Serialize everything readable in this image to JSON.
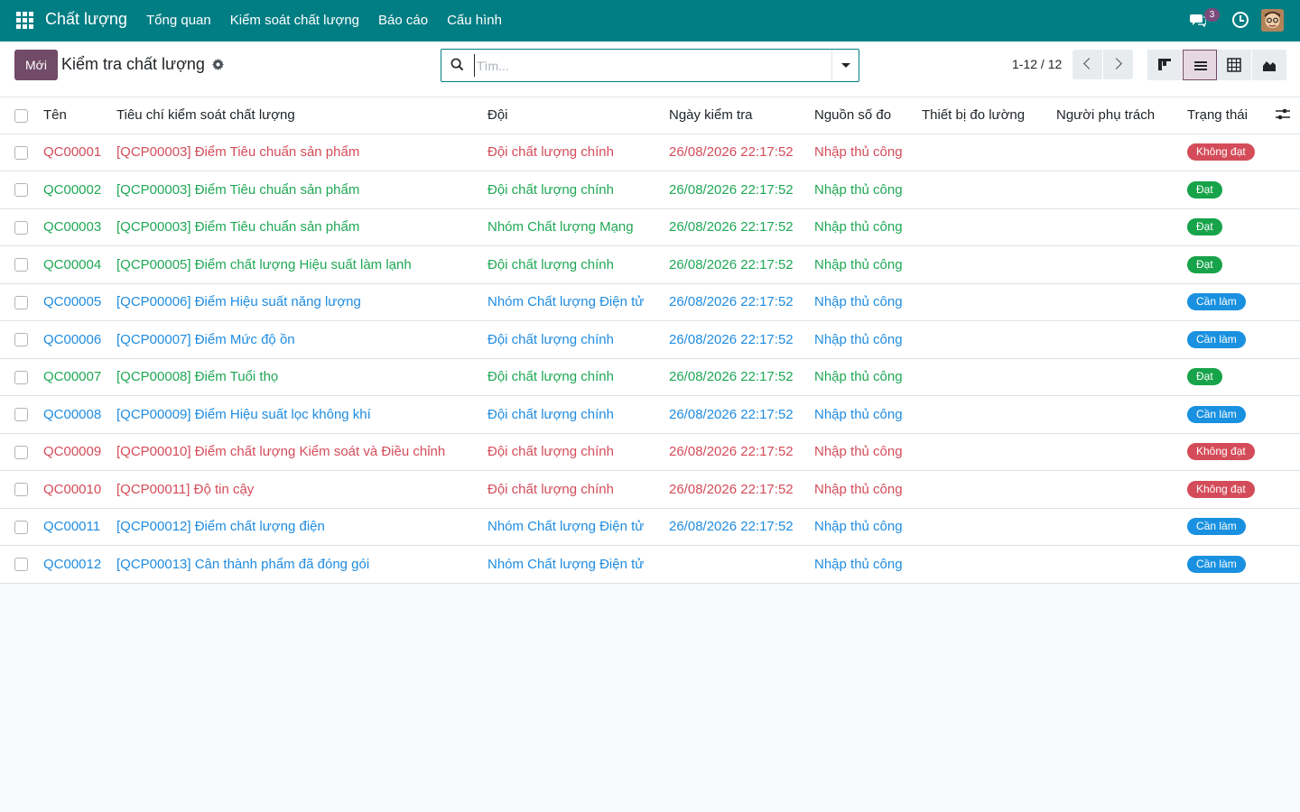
{
  "navbar": {
    "brand": "Chất lượng",
    "menu": [
      {
        "label": "Tổng quan"
      },
      {
        "label": "Kiểm soát chất lượng"
      },
      {
        "label": "Báo cáo"
      },
      {
        "label": "Cấu hình"
      }
    ],
    "chat_badge": "3"
  },
  "control": {
    "new_label": "Mới",
    "title": "Kiểm tra chất lượng",
    "search_placeholder": "Tìm...",
    "pager": "1-12 / 12"
  },
  "table": {
    "headers": {
      "name": "Tên",
      "criteria": "Tiêu chí kiểm soát chất lượng",
      "team": "Đội",
      "date": "Ngày kiểm tra",
      "source": "Nguồn số đo",
      "device": "Thiết bị đo lường",
      "responsible": "Người phụ trách",
      "status": "Trạng thái"
    },
    "rows": [
      {
        "name": "QC00001",
        "criteria": "[QCP00003] Điểm Tiêu chuẩn sản phẩm",
        "team": "Đội chất lượng chính",
        "date": "26/08/2026 22:17:52",
        "source": "Nhập thủ công",
        "status": "Không đạt",
        "tone": "red"
      },
      {
        "name": "QC00002",
        "criteria": "[QCP00003] Điểm Tiêu chuẩn sản phẩm",
        "team": "Đội chất lượng chính",
        "date": "26/08/2026 22:17:52",
        "source": "Nhập thủ công",
        "status": "Đạt",
        "tone": "green"
      },
      {
        "name": "QC00003",
        "criteria": "[QCP00003] Điểm Tiêu chuẩn sản phẩm",
        "team": "Nhóm Chất lượng Mạng",
        "date": "26/08/2026 22:17:52",
        "source": "Nhập thủ công",
        "status": "Đạt",
        "tone": "green"
      },
      {
        "name": "QC00004",
        "criteria": "[QCP00005] Điểm chất lượng Hiệu suất làm lạnh",
        "team": "Đội chất lượng chính",
        "date": "26/08/2026 22:17:52",
        "source": "Nhập thủ công",
        "status": "Đạt",
        "tone": "green"
      },
      {
        "name": "QC00005",
        "criteria": "[QCP00006] Điểm Hiệu suất năng lượng",
        "team": "Nhóm Chất lượng Điện tử",
        "date": "26/08/2026 22:17:52",
        "source": "Nhập thủ công",
        "status": "Cần làm",
        "tone": "blue"
      },
      {
        "name": "QC00006",
        "criteria": "[QCP00007] Điểm Mức độ ồn",
        "team": "Đội chất lượng chính",
        "date": "26/08/2026 22:17:52",
        "source": "Nhập thủ công",
        "status": "Cần làm",
        "tone": "blue"
      },
      {
        "name": "QC00007",
        "criteria": "[QCP00008] Điểm Tuổi thọ",
        "team": "Đội chất lượng chính",
        "date": "26/08/2026 22:17:52",
        "source": "Nhập thủ công",
        "status": "Đạt",
        "tone": "green"
      },
      {
        "name": "QC00008",
        "criteria": "[QCP00009] Điểm Hiệu suất lọc không khí",
        "team": "Đội chất lượng chính",
        "date": "26/08/2026 22:17:52",
        "source": "Nhập thủ công",
        "status": "Cần làm",
        "tone": "blue"
      },
      {
        "name": "QC00009",
        "criteria": "[QCP00010] Điểm chất lượng Kiểm soát và Điều chỉnh",
        "team": "Đội chất lượng chính",
        "date": "26/08/2026 22:17:52",
        "source": "Nhập thủ công",
        "status": "Không đạt",
        "tone": "red"
      },
      {
        "name": "QC00010",
        "criteria": "[QCP00011] Độ tin cậy",
        "team": "Đội chất lượng chính",
        "date": "26/08/2026 22:17:52",
        "source": "Nhập thủ công",
        "status": "Không đạt",
        "tone": "red"
      },
      {
        "name": "QC00011",
        "criteria": "[QCP00012] Điểm chất lượng điện",
        "team": "Nhóm Chất lượng Điện tử",
        "date": "26/08/2026 22:17:52",
        "source": "Nhập thủ công",
        "status": "Cần làm",
        "tone": "blue"
      },
      {
        "name": "QC00012",
        "criteria": "[QCP00013] Cân thành phẩm đã đóng gói",
        "team": "Nhóm Chất lượng Điện tử",
        "date": "",
        "source": "Nhập thủ công",
        "status": "Cần làm",
        "tone": "blue"
      }
    ]
  },
  "colors": {
    "navbar": "#017e84",
    "primary": "#714b67",
    "fail": "#d44c59",
    "pass": "#17a34a",
    "todo": "#1991e0"
  }
}
